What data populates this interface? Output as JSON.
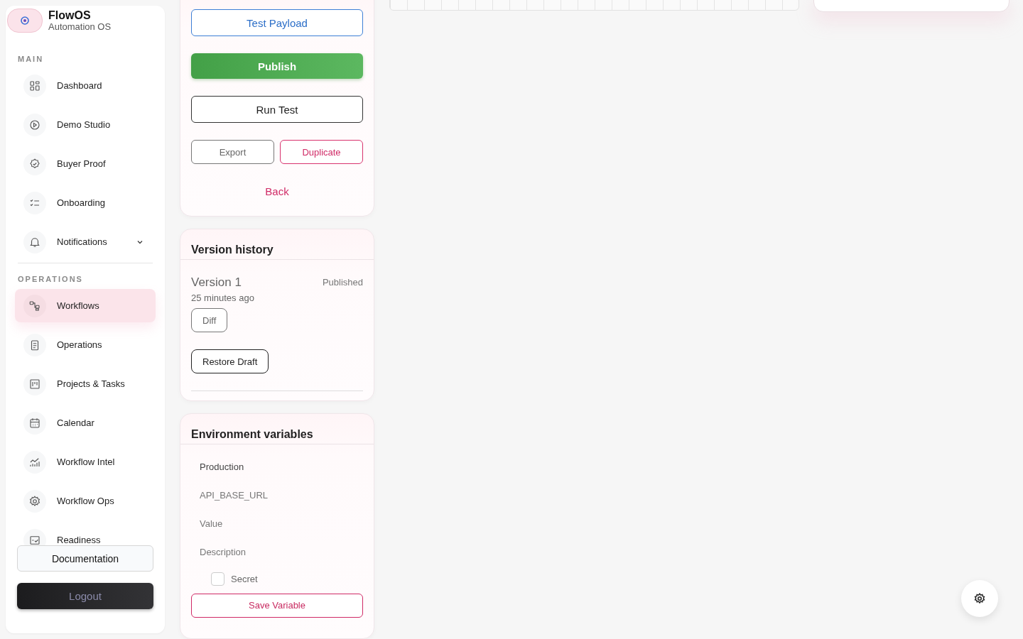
{
  "brand": {
    "name": "FlowOS",
    "subtitle": "Automation OS"
  },
  "sidebar": {
    "sections": [
      {
        "label": "MAIN",
        "items": [
          {
            "label": "Dashboard",
            "kind": "link",
            "selected": false
          },
          {
            "label": "Demo Studio",
            "kind": "link",
            "selected": false
          },
          {
            "label": "Buyer Proof",
            "kind": "link",
            "selected": false
          },
          {
            "label": "Onboarding",
            "kind": "link",
            "selected": false
          },
          {
            "label": "Notifications",
            "kind": "group",
            "selected": false,
            "expanded": false
          }
        ]
      },
      {
        "label": "OPERATIONS",
        "items": [
          {
            "label": "Workflows",
            "kind": "link",
            "selected": true
          },
          {
            "label": "Operations",
            "kind": "link",
            "selected": false
          },
          {
            "label": "Projects & Tasks",
            "kind": "link",
            "selected": false
          },
          {
            "label": "Calendar",
            "kind": "link",
            "selected": false
          },
          {
            "label": "Workflow Intel",
            "kind": "link",
            "selected": false
          },
          {
            "label": "Workflow Ops",
            "kind": "link",
            "selected": false
          },
          {
            "label": "Readiness",
            "kind": "link",
            "selected": false
          }
        ]
      }
    ],
    "buttons": [
      "Documentation",
      "Logout"
    ]
  },
  "actions": {
    "buttons": [
      {
        "label": "Test Payload",
        "kind": "outline-blue"
      },
      {
        "label": "Publish",
        "kind": "primary"
      },
      {
        "label": "Run Test",
        "kind": "outline-dark"
      }
    ],
    "pair": [
      {
        "label": "Export",
        "kind": "outline-gray"
      },
      {
        "label": "Duplicate",
        "kind": "outline-pink"
      }
    ],
    "link": "Back"
  },
  "version_history": {
    "title": "Version history",
    "versions": [
      {
        "name": "Version 1",
        "status": "Published",
        "time": "25 minutes ago",
        "buttons": [
          "Diff",
          "Restore Draft"
        ]
      }
    ]
  },
  "environment_variables": {
    "title": "Environment variables",
    "fields": [
      {
        "value": "Production"
      },
      {
        "placeholder": "API_BASE_URL"
      },
      {
        "placeholder": "Value"
      },
      {
        "placeholder": "Description"
      }
    ],
    "secret": {
      "label": "Secret",
      "checked": false
    },
    "button": "Save Variable"
  }
}
